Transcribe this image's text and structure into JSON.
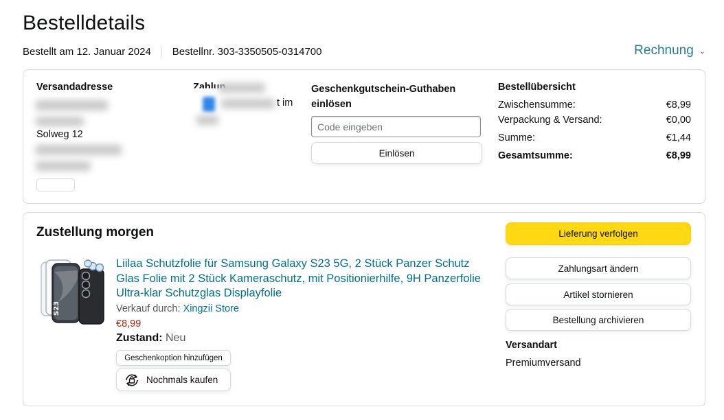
{
  "header": {
    "title": "Bestelldetails",
    "order_date": "Bestellt am 12. Januar 2024",
    "order_number": "Bestellnr. 303-3350505-0314700",
    "invoice_label": "Rechnung"
  },
  "shipping_address": {
    "heading": "Versandadresse",
    "visible_line": "Solweg 12"
  },
  "payment": {
    "heading_partial": "Zahlun",
    "visible_fragment": "t im"
  },
  "gift_card": {
    "heading": "Geschenkgutschein-Guthaben einlösen",
    "placeholder": "Code eingeben",
    "redeem_label": "Einlösen"
  },
  "order_summary": {
    "heading": "Bestellübersicht",
    "rows": [
      {
        "label": "Zwischensumme:",
        "value": "€8,99"
      },
      {
        "label": "Verpackung & Versand:",
        "value": "€0,00"
      },
      {
        "label": "Summe:",
        "value": "€1,44"
      }
    ],
    "total": {
      "label": "Gesamtsumme:",
      "value": "€8,99"
    }
  },
  "delivery": {
    "heading": "Zustellung morgen",
    "product": {
      "title": "Liilaa Schutzfolie für Samsung Galaxy S23 5G, 2 Stück Panzer Schutz Glas Folie mit 2 Stück Kameraschutz, mit Positionierhilfe, 9H Panzerfolie Ultra-klar Schutzglas Displayfolie",
      "sold_by_label": "Verkauf durch:",
      "seller": "Xingzii Store",
      "price": "€8,99",
      "condition_label": "Zustand:",
      "condition_value": "Neu",
      "gift_option_label": "Geschenkoption hinzufügen",
      "buy_again_label": "Nochmals kaufen",
      "buy_again_icon": "rebuy-icon"
    },
    "actions": {
      "track": "Lieferung verfolgen",
      "change_payment": "Zahlungsart ändern",
      "cancel": "Artikel stornieren",
      "archive": "Bestellung archivieren"
    },
    "shipping_method_heading": "Versandart",
    "shipping_method_value": "Premiumversand"
  },
  "colors": {
    "link": "#007185",
    "invoice_link": "#2a7b8e",
    "price": "#b12704",
    "primary_button": "#ffd814",
    "border": "#d5d9d9"
  }
}
